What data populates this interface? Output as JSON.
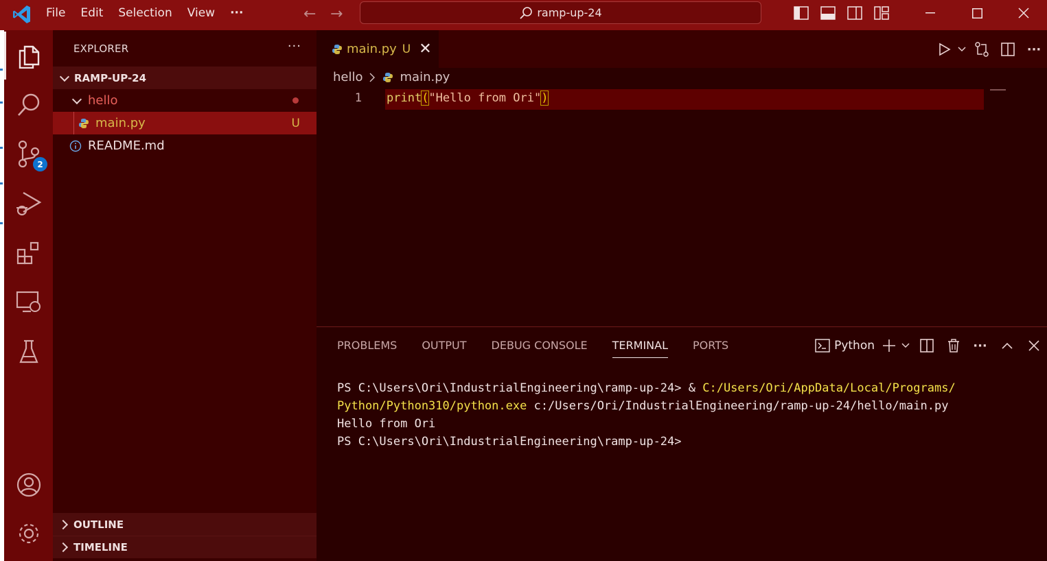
{
  "colors": {
    "titlebar": "#880f0f",
    "activitybar": "#6a0606",
    "sidebar": "#3a0000",
    "editor": "#2a0000",
    "accent_badge": "#0e73cf",
    "modified_text": "#d7b84a"
  },
  "titlebar": {
    "menu": [
      "File",
      "Edit",
      "Selection",
      "View",
      "···"
    ],
    "search_text": "ramp-up-24"
  },
  "activity": {
    "source_control_badge": "2",
    "icons": [
      "explorer-icon",
      "search-icon",
      "source-control-icon",
      "run-debug-icon",
      "extensions-icon",
      "remote-explorer-icon",
      "testing-icon",
      "accounts-icon",
      "manage-gear-icon"
    ]
  },
  "sidebar": {
    "title": "EXPLORER",
    "more": "···",
    "root": "RAMP-UP-24",
    "folder": "hello",
    "file_main": "main.py",
    "file_main_status": "U",
    "file_readme": "README.md",
    "outline": "OUTLINE",
    "timeline": "TIMELINE"
  },
  "editor": {
    "tab_label": "main.py",
    "tab_status": "U",
    "breadcrumb_folder": "hello",
    "breadcrumb_file": "main.py",
    "line_number": "1",
    "code_fn": "print",
    "code_open": "(",
    "code_str": "\"Hello from Ori\"",
    "code_close": ")"
  },
  "panel": {
    "tabs": [
      "PROBLEMS",
      "OUTPUT",
      "DEBUG CONSOLE",
      "TERMINAL",
      "PORTS"
    ],
    "active_tab": "TERMINAL",
    "terminal_name": "Python",
    "lines": {
      "l1_prompt": "PS C:\\Users\\Ori\\IndustrialEngineering\\ramp-up-24> ",
      "l1_amp": "& ",
      "l1_path": "C:/Users/Ori/AppData/Local/Programs/",
      "l2_path": "Python/Python310/python.exe",
      "l2_arg": " c:/Users/Ori/IndustrialEngineering/ramp-up-24/hello/main.py",
      "l3": "Hello from Ori",
      "l4": "PS C:\\Users\\Ori\\IndustrialEngineering\\ramp-up-24>"
    }
  }
}
